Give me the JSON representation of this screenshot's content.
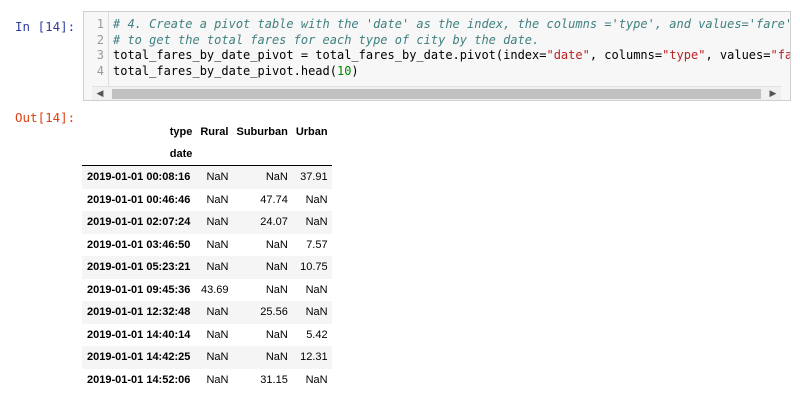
{
  "input_prompt": "In [14]:",
  "output_prompt": "Out[14]:",
  "code": {
    "line_numbers": [
      "1",
      "2",
      "3",
      "4"
    ],
    "line1_comment": "# 4. Create a pivot table with the 'date' as the index, the columns ='type', and values='fare'",
    "line2_comment": "# to get the total fares for each type of city by the date.",
    "line3_a": "total_fares_by_date_pivot = total_fares_by_date.pivot(index=",
    "line3_s1": "\"date\"",
    "line3_b": ", columns=",
    "line3_s2": "\"type\"",
    "line3_c": ", values=",
    "line3_s3": "\"fare\"",
    "line3_d": ")",
    "line4_a": "total_fares_by_date_pivot.head(",
    "line4_num": "10",
    "line4_b": ")"
  },
  "scroll": {
    "left_arrow": "◀",
    "right_arrow": "▶"
  },
  "table": {
    "columns_name": "type",
    "index_name": "date",
    "columns": [
      "Rural",
      "Suburban",
      "Urban"
    ],
    "rows": [
      {
        "date": "2019-01-01 00:08:16",
        "values": [
          "NaN",
          "NaN",
          "37.91"
        ]
      },
      {
        "date": "2019-01-01 00:46:46",
        "values": [
          "NaN",
          "47.74",
          "NaN"
        ]
      },
      {
        "date": "2019-01-01 02:07:24",
        "values": [
          "NaN",
          "24.07",
          "NaN"
        ]
      },
      {
        "date": "2019-01-01 03:46:50",
        "values": [
          "NaN",
          "NaN",
          "7.57"
        ]
      },
      {
        "date": "2019-01-01 05:23:21",
        "values": [
          "NaN",
          "NaN",
          "10.75"
        ]
      },
      {
        "date": "2019-01-01 09:45:36",
        "values": [
          "43.69",
          "NaN",
          "NaN"
        ]
      },
      {
        "date": "2019-01-01 12:32:48",
        "values": [
          "NaN",
          "25.56",
          "NaN"
        ]
      },
      {
        "date": "2019-01-01 14:40:14",
        "values": [
          "NaN",
          "NaN",
          "5.42"
        ]
      },
      {
        "date": "2019-01-01 14:42:25",
        "values": [
          "NaN",
          "NaN",
          "12.31"
        ]
      },
      {
        "date": "2019-01-01 14:52:06",
        "values": [
          "NaN",
          "31.15",
          "NaN"
        ]
      }
    ]
  }
}
